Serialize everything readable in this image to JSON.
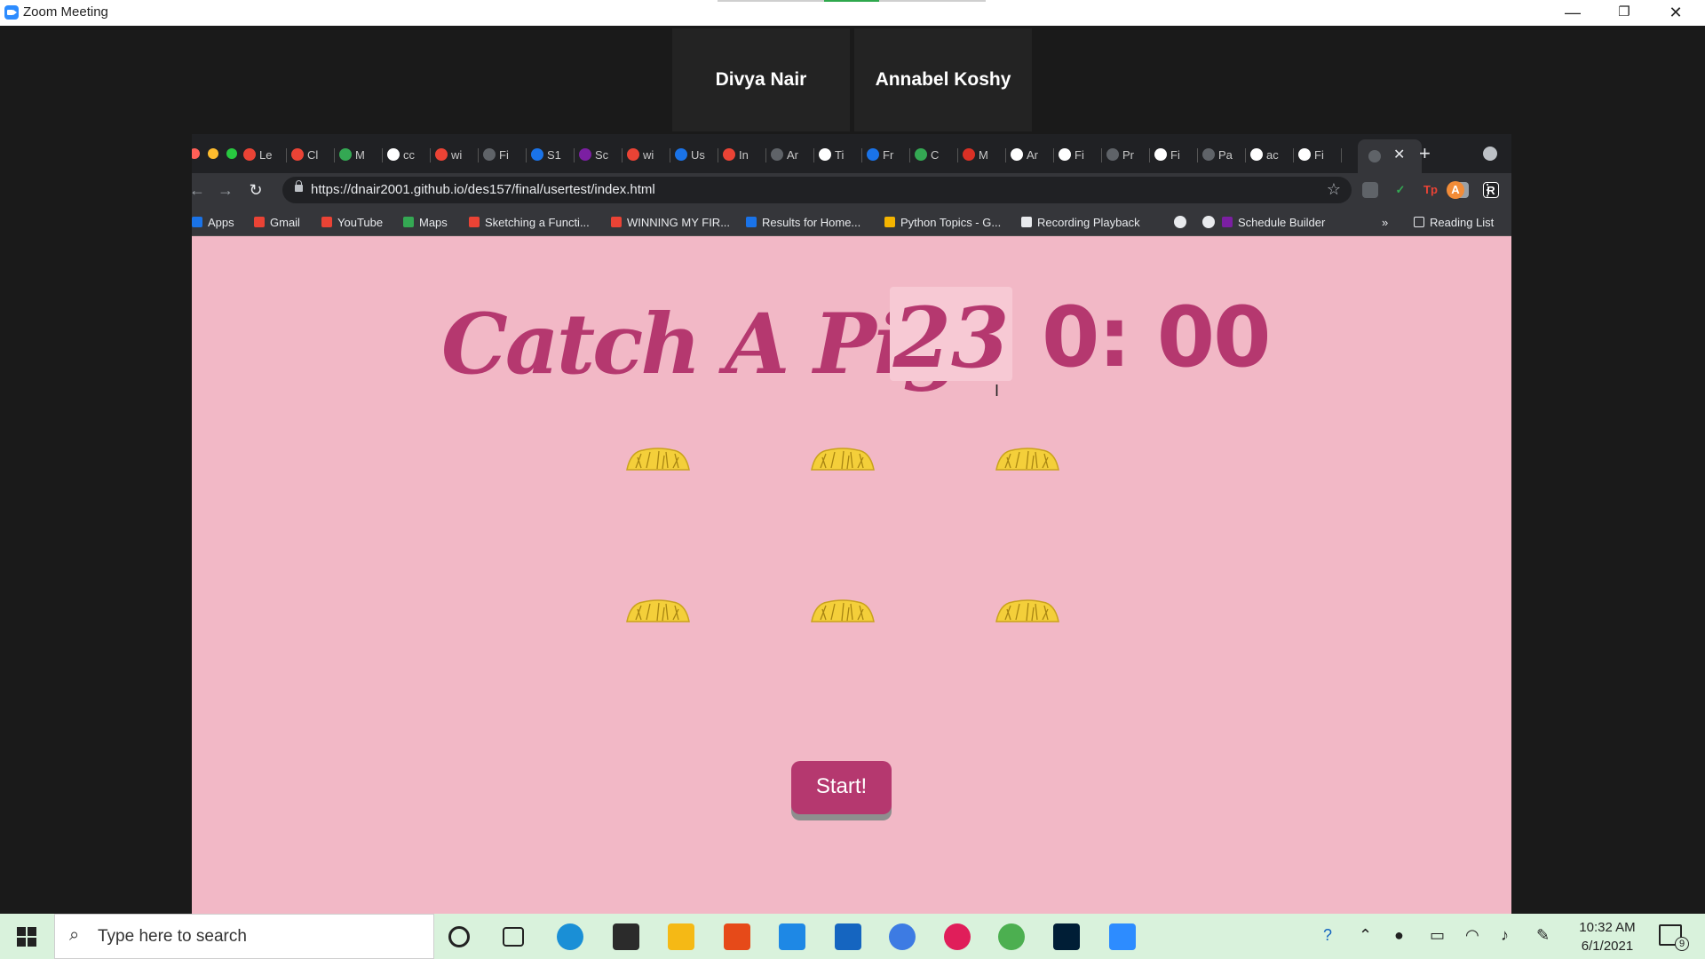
{
  "window": {
    "title": "Zoom Meeting",
    "minimize": "—",
    "restore": "❐",
    "close": "✕"
  },
  "participants": [
    {
      "name": "Divya Nair"
    },
    {
      "name": "Annabel Koshy"
    }
  ],
  "browser": {
    "tabs": [
      "Le",
      "Cl",
      "M",
      "cc",
      "wi",
      "Fi",
      "S1",
      "Sc",
      "wi",
      "Us",
      "In",
      "Ar",
      "Ti",
      "Fr",
      "C",
      "M",
      "Ar",
      "Fi",
      "Pr",
      "Fi",
      "Pa",
      "ac",
      "Fi"
    ],
    "new_tab": "+",
    "url": "https://dnair2001.github.io/des157/final/usertest/index.html",
    "bookmarks": [
      "Apps",
      "Gmail",
      "YouTube",
      "Maps",
      "Sketching a Functi...",
      "WINNING MY FIR...",
      "Results for Home...",
      "Python Topics - G...",
      "Recording Playback",
      "Schedule Builder"
    ],
    "bookmarks_more": "»",
    "reading_list": "Reading List",
    "profile_initial": "A",
    "accent": "#f28c38"
  },
  "game": {
    "title": "Catch A Pig!",
    "score": "23",
    "timer": "0: 00",
    "start_label": "Start!",
    "colors": {
      "background": "#f2b8c6",
      "accent": "#b5386f",
      "hay": "#f4cf3a"
    },
    "hay_piles": 6
  },
  "taskbar": {
    "search_placeholder": "Type here to search",
    "time": "10:32 AM",
    "date": "6/1/2021",
    "notifications": "9"
  }
}
